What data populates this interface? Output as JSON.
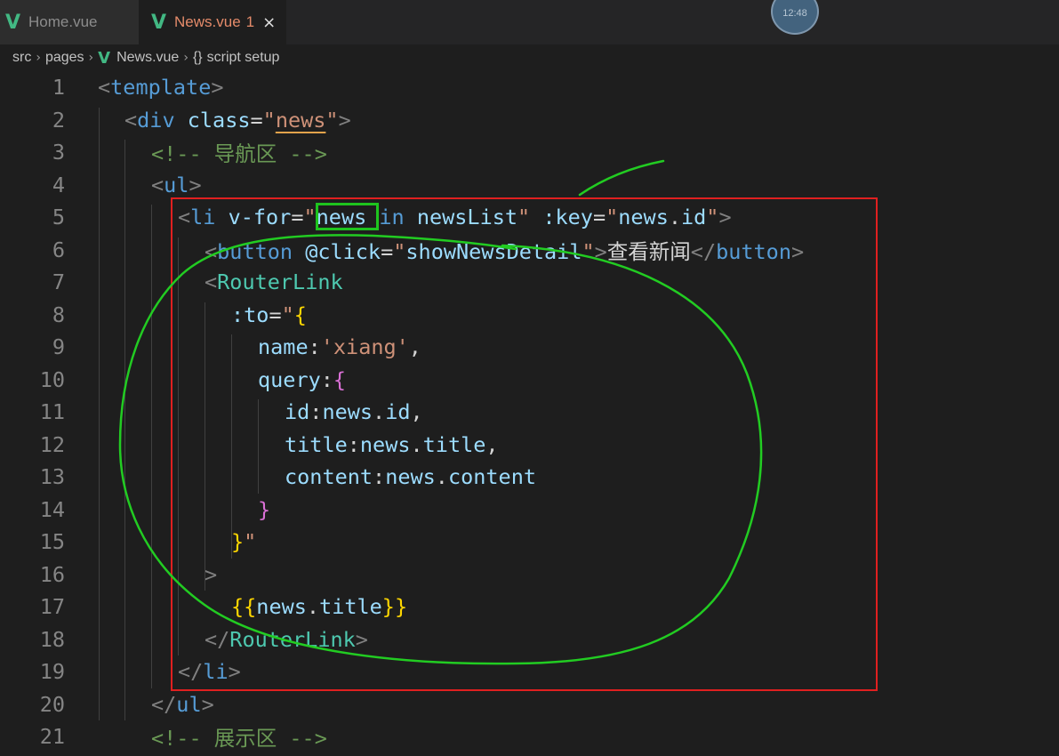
{
  "tabs": [
    {
      "logo": "V",
      "label": "Home.vue",
      "active": false
    },
    {
      "logo": "V",
      "label": "News.vue",
      "badge": "1",
      "close": "×",
      "active": true
    }
  ],
  "clock": "12:48",
  "breadcrumb": {
    "parts": [
      "src",
      "pages",
      "News.vue",
      "script setup"
    ],
    "separator": "›",
    "braces": "{}"
  },
  "code": {
    "line_numbers": [
      "1",
      "2",
      "3",
      "4",
      "5",
      "6",
      "7",
      "8",
      "9",
      "10",
      "11",
      "12",
      "13",
      "14",
      "15",
      "16",
      "17",
      "18",
      "19",
      "20",
      "21"
    ],
    "lines": [
      [
        {
          "t": "<",
          "c": "c-tag"
        },
        {
          "t": "template",
          "c": "c-el"
        },
        {
          "t": ">",
          "c": "c-tag"
        }
      ],
      [
        {
          "t": "<",
          "c": "c-tag"
        },
        {
          "t": "div",
          "c": "c-el"
        },
        {
          "t": " class",
          "c": "c-attr"
        },
        {
          "t": "=",
          "c": "c-txt"
        },
        {
          "t": "\"",
          "c": "c-str"
        },
        {
          "t": "news",
          "c": "c-str squig"
        },
        {
          "t": "\"",
          "c": "c-str"
        },
        {
          "t": ">",
          "c": "c-tag"
        }
      ],
      [
        {
          "t": "<!-- ",
          "c": "c-com"
        },
        {
          "t": "导航区",
          "c": "c-com c-cjk"
        },
        {
          "t": " -->",
          "c": "c-com"
        }
      ],
      [
        {
          "t": "<",
          "c": "c-tag"
        },
        {
          "t": "ul",
          "c": "c-el"
        },
        {
          "t": ">",
          "c": "c-tag"
        }
      ],
      [
        {
          "t": "<",
          "c": "c-tag"
        },
        {
          "t": "li",
          "c": "c-el"
        },
        {
          "t": " v-for",
          "c": "c-attr"
        },
        {
          "t": "=",
          "c": "c-txt"
        },
        {
          "t": "\"",
          "c": "c-str"
        },
        {
          "t": "news",
          "c": "c-attr"
        },
        {
          "t": " in ",
          "c": "c-el"
        },
        {
          "t": "newsList",
          "c": "c-attr"
        },
        {
          "t": "\"",
          "c": "c-str"
        },
        {
          "t": " :key",
          "c": "c-attr"
        },
        {
          "t": "=",
          "c": "c-txt"
        },
        {
          "t": "\"",
          "c": "c-str"
        },
        {
          "t": "news",
          "c": "c-attr"
        },
        {
          "t": ".",
          "c": "c-txt"
        },
        {
          "t": "id",
          "c": "c-attr"
        },
        {
          "t": "\"",
          "c": "c-str"
        },
        {
          "t": ">",
          "c": "c-tag"
        }
      ],
      [
        {
          "t": "<",
          "c": "c-tag"
        },
        {
          "t": "button",
          "c": "c-el"
        },
        {
          "t": " @click",
          "c": "c-attr"
        },
        {
          "t": "=",
          "c": "c-txt"
        },
        {
          "t": "\"",
          "c": "c-str"
        },
        {
          "t": "showNewsDetail",
          "c": "c-attr"
        },
        {
          "t": "\"",
          "c": "c-str"
        },
        {
          "t": ">",
          "c": "c-tag"
        },
        {
          "t": "查看新闻",
          "c": "c-txt c-cjk"
        },
        {
          "t": "</",
          "c": "c-tag"
        },
        {
          "t": "button",
          "c": "c-el"
        },
        {
          "t": ">",
          "c": "c-tag"
        }
      ],
      [
        {
          "t": "<",
          "c": "c-tag"
        },
        {
          "t": "RouterLink",
          "c": "c-comp"
        }
      ],
      [
        {
          "t": ":to",
          "c": "c-attr"
        },
        {
          "t": "=",
          "c": "c-txt"
        },
        {
          "t": "\"",
          "c": "c-str"
        },
        {
          "t": "{",
          "c": "c-br1"
        }
      ],
      [
        {
          "t": "name",
          "c": "c-attr"
        },
        {
          "t": ":",
          "c": "c-txt"
        },
        {
          "t": "'xiang'",
          "c": "c-str"
        },
        {
          "t": ",",
          "c": "c-txt"
        }
      ],
      [
        {
          "t": "query",
          "c": "c-attr"
        },
        {
          "t": ":",
          "c": "c-txt"
        },
        {
          "t": "{",
          "c": "c-br2"
        }
      ],
      [
        {
          "t": "id",
          "c": "c-attr"
        },
        {
          "t": ":",
          "c": "c-txt"
        },
        {
          "t": "news",
          "c": "c-attr"
        },
        {
          "t": ".",
          "c": "c-txt"
        },
        {
          "t": "id",
          "c": "c-attr"
        },
        {
          "t": ",",
          "c": "c-txt"
        }
      ],
      [
        {
          "t": "title",
          "c": "c-attr"
        },
        {
          "t": ":",
          "c": "c-txt"
        },
        {
          "t": "news",
          "c": "c-attr"
        },
        {
          "t": ".",
          "c": "c-txt"
        },
        {
          "t": "title",
          "c": "c-attr"
        },
        {
          "t": ",",
          "c": "c-txt"
        }
      ],
      [
        {
          "t": "content",
          "c": "c-attr"
        },
        {
          "t": ":",
          "c": "c-txt"
        },
        {
          "t": "news",
          "c": "c-attr"
        },
        {
          "t": ".",
          "c": "c-txt"
        },
        {
          "t": "content",
          "c": "c-attr"
        }
      ],
      [
        {
          "t": "}",
          "c": "c-br2"
        }
      ],
      [
        {
          "t": "}",
          "c": "c-br1"
        },
        {
          "t": "\"",
          "c": "c-str"
        }
      ],
      [
        {
          "t": ">",
          "c": "c-tag"
        }
      ],
      [
        {
          "t": "{{",
          "c": "c-br1"
        },
        {
          "t": "news",
          "c": "c-attr"
        },
        {
          "t": ".",
          "c": "c-txt"
        },
        {
          "t": "title",
          "c": "c-attr"
        },
        {
          "t": "}}",
          "c": "c-br1"
        }
      ],
      [
        {
          "t": "</",
          "c": "c-tag"
        },
        {
          "t": "RouterLink",
          "c": "c-comp"
        },
        {
          "t": ">",
          "c": "c-tag"
        }
      ],
      [
        {
          "t": "</",
          "c": "c-tag"
        },
        {
          "t": "li",
          "c": "c-el"
        },
        {
          "t": ">",
          "c": "c-tag"
        }
      ],
      [
        {
          "t": "</",
          "c": "c-tag"
        },
        {
          "t": "ul",
          "c": "c-el"
        },
        {
          "t": ">",
          "c": "c-tag"
        }
      ],
      [
        {
          "t": "<!-- ",
          "c": "c-com"
        },
        {
          "t": "展示区",
          "c": "c-com c-cjk"
        },
        {
          "t": " -->",
          "c": "c-com"
        }
      ]
    ]
  },
  "colors": {
    "annotation_box": "#e02020",
    "annotation_highlight": "#1ec41e",
    "annotation_ink": "#22cc22",
    "vue_logo": "#42b883"
  }
}
